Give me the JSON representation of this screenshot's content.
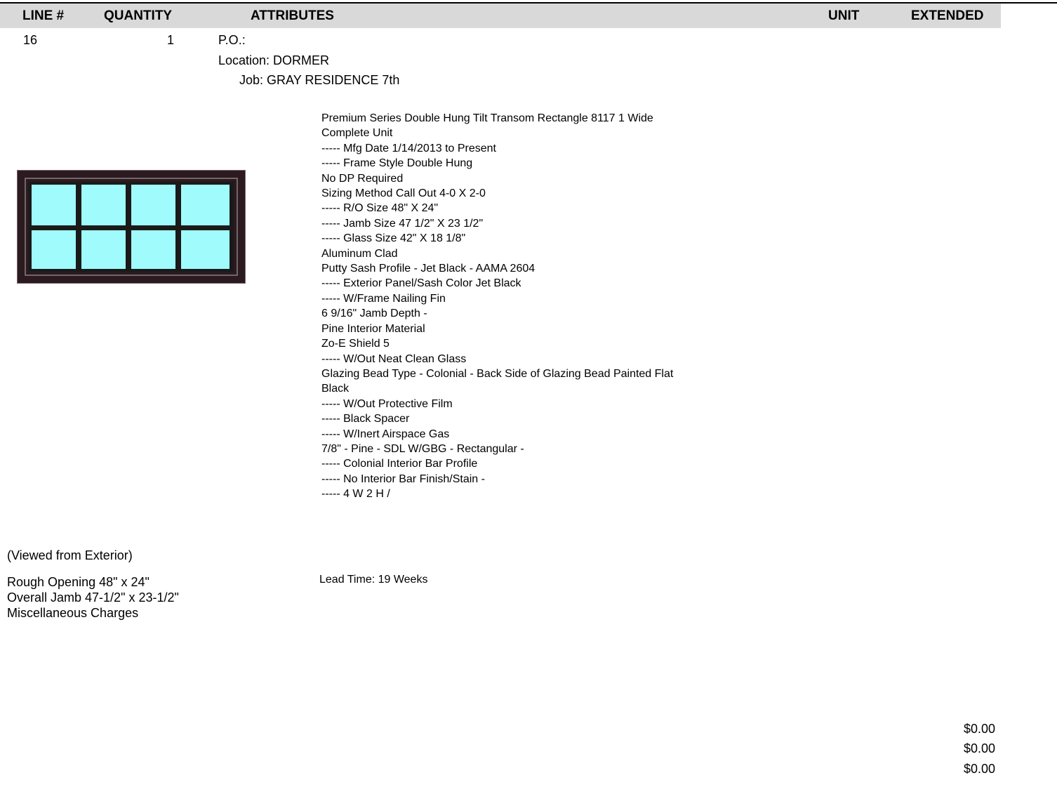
{
  "table_header": {
    "line": "LINE #",
    "quantity": "QUANTITY",
    "attributes": "ATTRIBUTES",
    "unit": "UNIT",
    "extended": "EXTENDED"
  },
  "item": {
    "line_number": "16",
    "quantity": "1",
    "po": "P.O.:",
    "location": "Location: DORMER",
    "job": "Job: GRAY RESIDENCE 7th",
    "attributes": [
      "Premium Series Double Hung Tilt Transom Rectangle 8117 1 Wide",
      "Complete Unit",
      "----- Mfg Date 1/14/2013 to Present",
      "----- Frame Style Double Hung",
      "No DP Required",
      "Sizing Method Call Out 4-0 X 2-0",
      "----- R/O Size 48\" X 24\"",
      "----- Jamb Size 47 1/2\" X 23 1/2\"",
      "----- Glass Size 42\" X 18 1/8\"",
      "Aluminum Clad",
      "Putty Sash Profile - Jet Black - AAMA 2604",
      "----- Exterior Panel/Sash Color Jet Black",
      "----- W/Frame Nailing Fin",
      "6 9/16\" Jamb Depth -",
      "Pine Interior Material",
      "Zo-E Shield 5",
      "----- W/Out Neat Clean Glass",
      "Glazing Bead Type - Colonial - Back Side of Glazing Bead Painted Flat",
      "Black",
      "----- W/Out Protective Film",
      "----- Black Spacer",
      "----- W/Inert Airspace Gas",
      "7/8\" - Pine - SDL W/GBG - Rectangular -",
      "----- Colonial Interior Bar Profile",
      "----- No Interior Bar Finish/Stain -",
      "----- 4 W 2 H /"
    ],
    "viewed_from": "(Viewed from Exterior)",
    "rough_opening": "Rough Opening 48\" x 24\"",
    "overall_jamb": "Overall Jamb 47-1/2\" x 23-1/2\"",
    "misc_charges": "Miscellaneous Charges",
    "lead_time": "Lead Time: 19 Weeks",
    "amounts": [
      "$0.00",
      "$0.00",
      "$0.00"
    ]
  },
  "colors": {
    "header_background": "#d9d9d9",
    "frame": "#2b1a1f",
    "glass": "#a0fcfc",
    "muntin": "#1a1a1a"
  }
}
